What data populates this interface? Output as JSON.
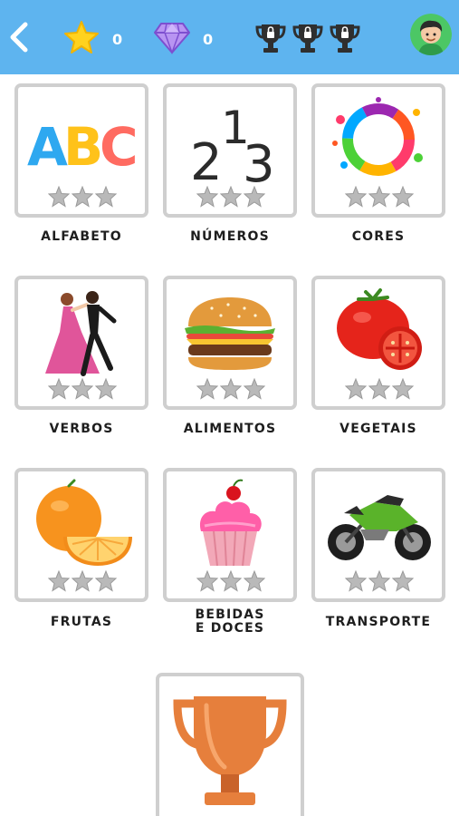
{
  "header": {
    "back_icon": "chevron-left-icon",
    "star_count": "0",
    "gem_count": "0",
    "trophies": [
      "locked-trophy-1",
      "locked-trophy-2",
      "locked-trophy-3"
    ],
    "avatar_icon": "boy-avatar-icon",
    "colors": {
      "bar": "#5eb4ef",
      "star": "#ffd21f",
      "gem": "#a678e6"
    }
  },
  "categories": [
    {
      "label": "ALFABETO",
      "art": "abc-letters",
      "stars_earned": 0,
      "stars_total": 3
    },
    {
      "label": "NÚMEROS",
      "art": "numbers-213",
      "stars_earned": 0,
      "stars_total": 3
    },
    {
      "label": "CORES",
      "art": "paint-splash-ring",
      "stars_earned": 0,
      "stars_total": 3
    },
    {
      "label": "VERBOS",
      "art": "dancing-couple",
      "stars_earned": 0,
      "stars_total": 3
    },
    {
      "label": "ALIMENTOS",
      "art": "hamburger",
      "stars_earned": 0,
      "stars_total": 3
    },
    {
      "label": "VEGETAIS",
      "art": "tomato",
      "stars_earned": 0,
      "stars_total": 3
    },
    {
      "label": "FRUTAS",
      "art": "orange",
      "stars_earned": 0,
      "stars_total": 3
    },
    {
      "label_line1": "BEBIDAS",
      "label_line2": "E DOCES",
      "art": "cupcake",
      "stars_earned": 0,
      "stars_total": 3
    },
    {
      "label": "TRANSPORTE",
      "art": "motorcycle",
      "stars_earned": 0,
      "stars_total": 3
    }
  ],
  "trophy_tile": {
    "art": "bronze-trophy-icon"
  }
}
